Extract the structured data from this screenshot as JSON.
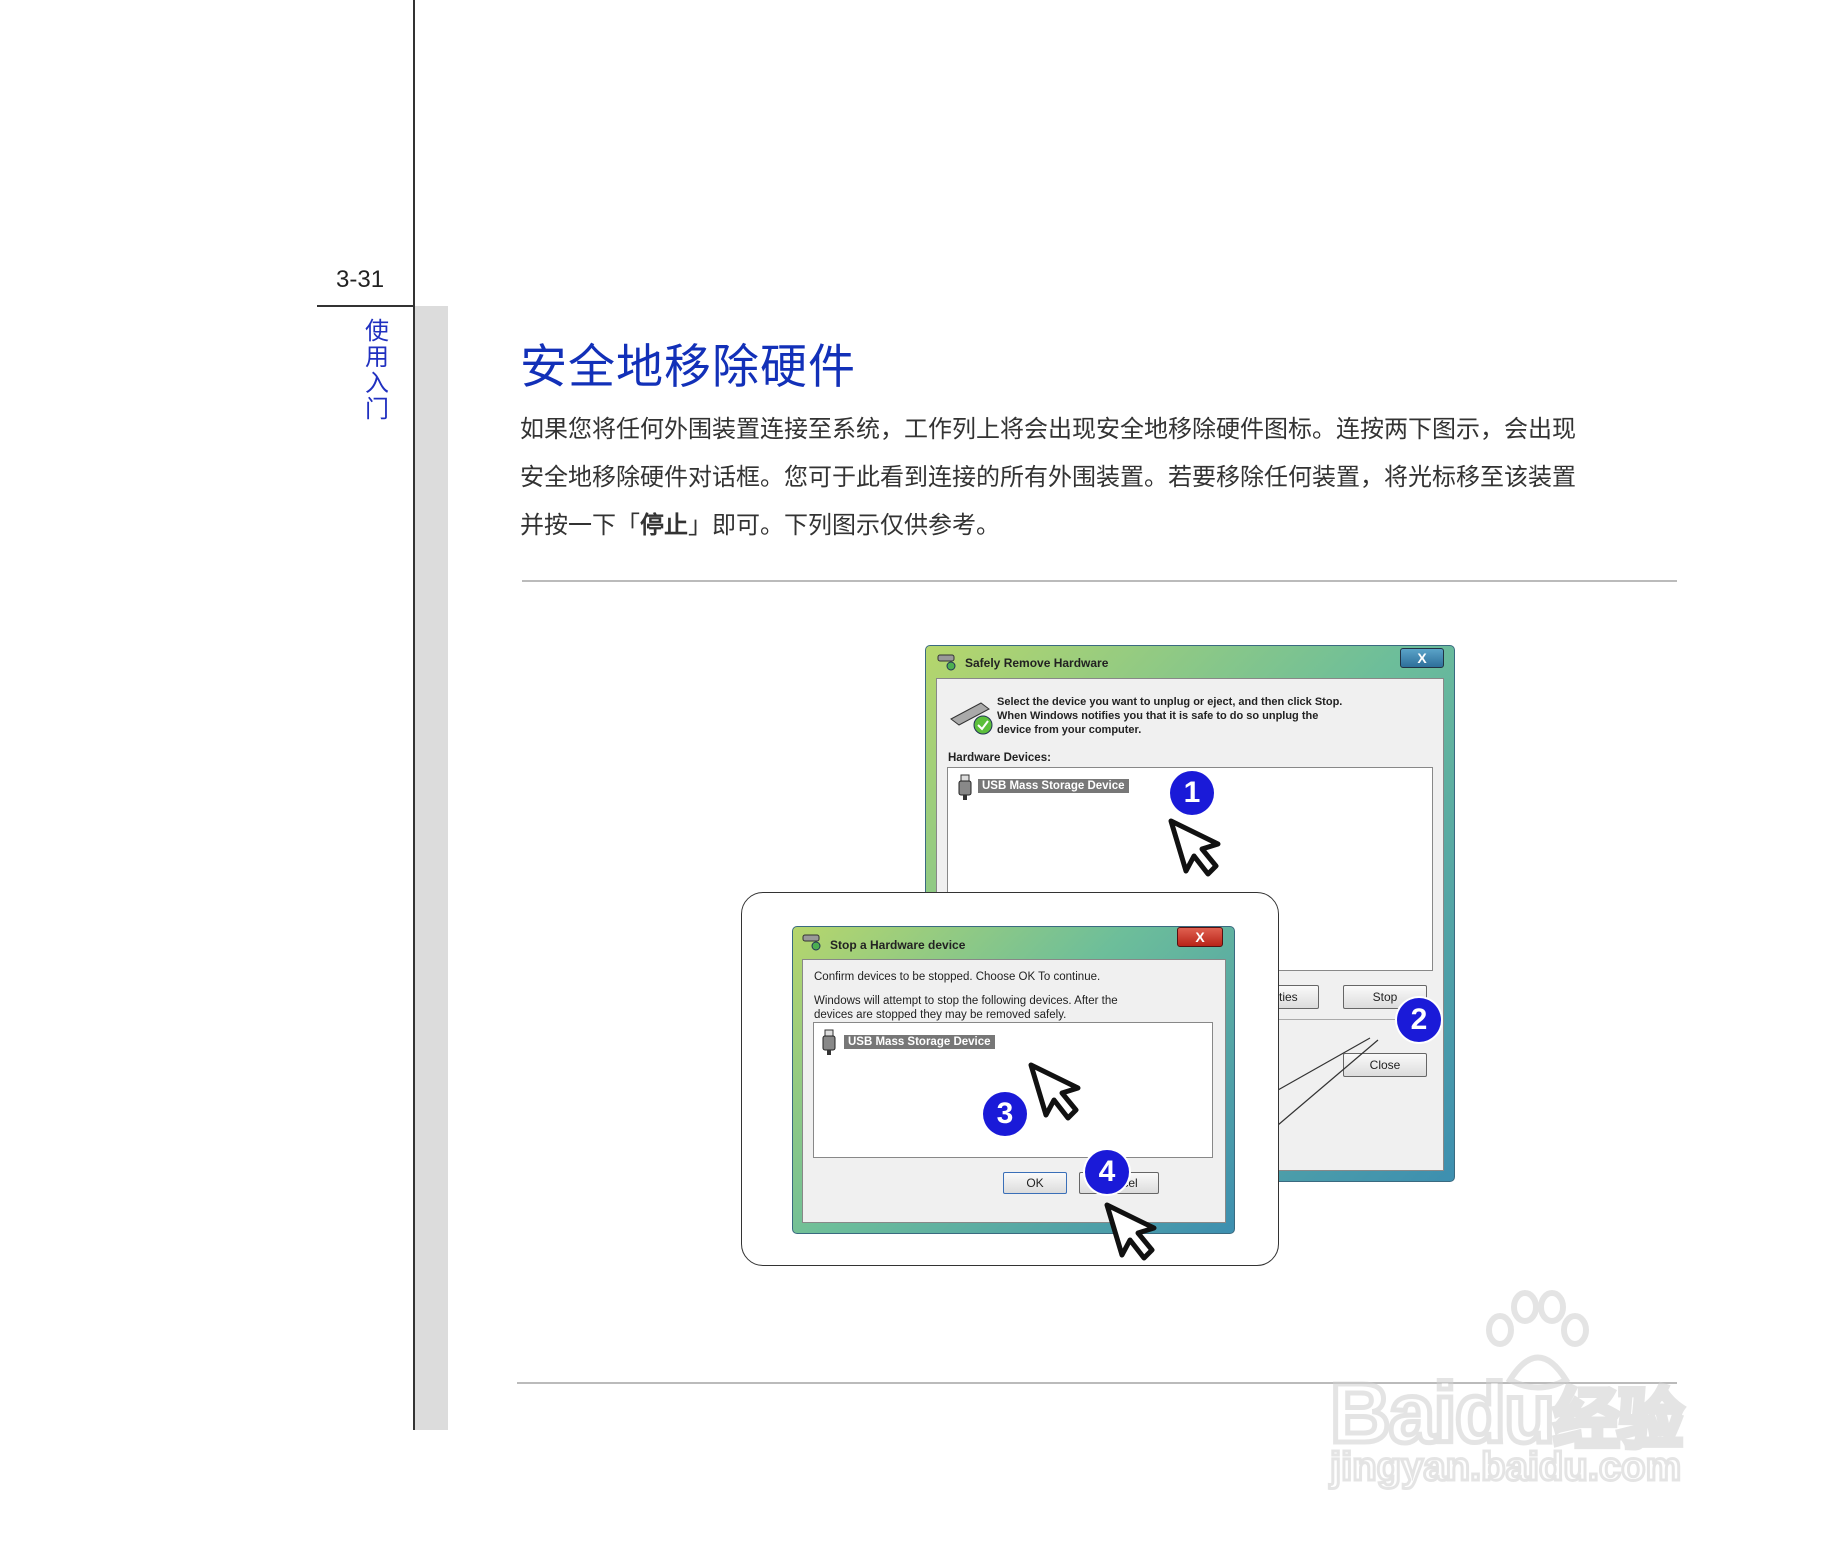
{
  "page": {
    "number": "3-31",
    "chapter": [
      "使",
      "用",
      "入",
      "门"
    ]
  },
  "section": {
    "title": "安全地移除硬件",
    "lines": [
      [
        "如果您将任何外围装置连接至系统，工作列上将会出现安全地移除硬件图标。连按两下图示，会出现"
      ],
      [
        "安全地移除硬件对话框。您可于此看到连接的所有外围装置。若要移除任何装置，将光标移至该装置"
      ],
      [
        "并按一下「",
        "停止",
        "」即可。下列图示仅供参考。"
      ]
    ]
  },
  "dialog_main": {
    "title": "Safely Remove Hardware",
    "close": "X",
    "instructions": [
      "Select the device you want to unplug or eject, and then click Stop.",
      "When Windows notifies you that it is safe to do so unplug the",
      "device from your computer."
    ],
    "list_label": "Hardware Devices:",
    "device": "USB Mass Storage Device",
    "properties_button": "erties",
    "stop_button": "Stop",
    "close_button": "Close"
  },
  "dialog_stop": {
    "title": "Stop a Hardware device",
    "close": "X",
    "confirm": "Confirm devices to be stopped.  Choose OK To continue.",
    "warning": [
      "Windows will attempt to stop the following devices. After the",
      "devices are stopped they may be removed safely."
    ],
    "device": "USB Mass Storage Device",
    "ok_button": "OK",
    "cancel_button": "Cancel"
  },
  "steps": [
    "1",
    "2",
    "3",
    "4"
  ],
  "watermark": {
    "brand": "Bai",
    "brand2": "du",
    "cn": "经验",
    "url": "jingyan.baidu.com"
  },
  "colors": {
    "title_blue": "#1230b8",
    "badge_blue": "#1a1ad8",
    "window_gradient": [
      "#b6d66c",
      "#59b2a0",
      "#3d8fb0"
    ]
  }
}
